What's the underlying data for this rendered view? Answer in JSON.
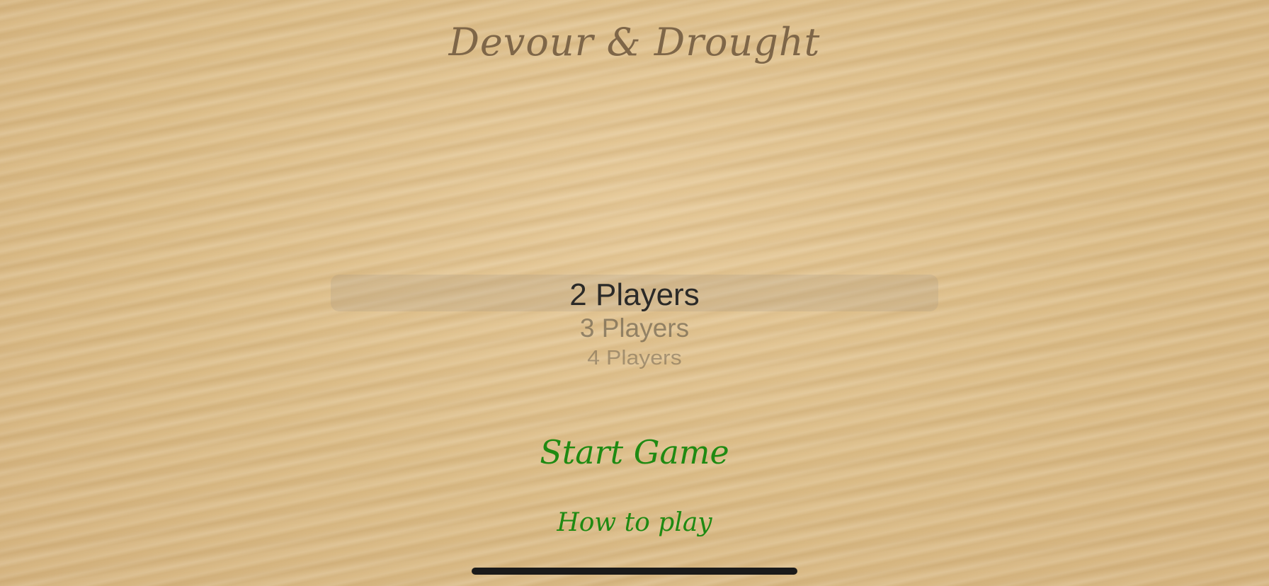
{
  "app": {
    "title": "Devour & Drought"
  },
  "player_picker": {
    "selected": "2 Players",
    "options": [
      "2 Players",
      "3 Players",
      "4 Players"
    ]
  },
  "actions": {
    "start_label": "Start Game",
    "howto_label": "How to play"
  },
  "colors": {
    "background": "#e0c18f",
    "title": "#7e6648",
    "action_green": "#1f8a12",
    "selected_option": "#2b2a28"
  }
}
